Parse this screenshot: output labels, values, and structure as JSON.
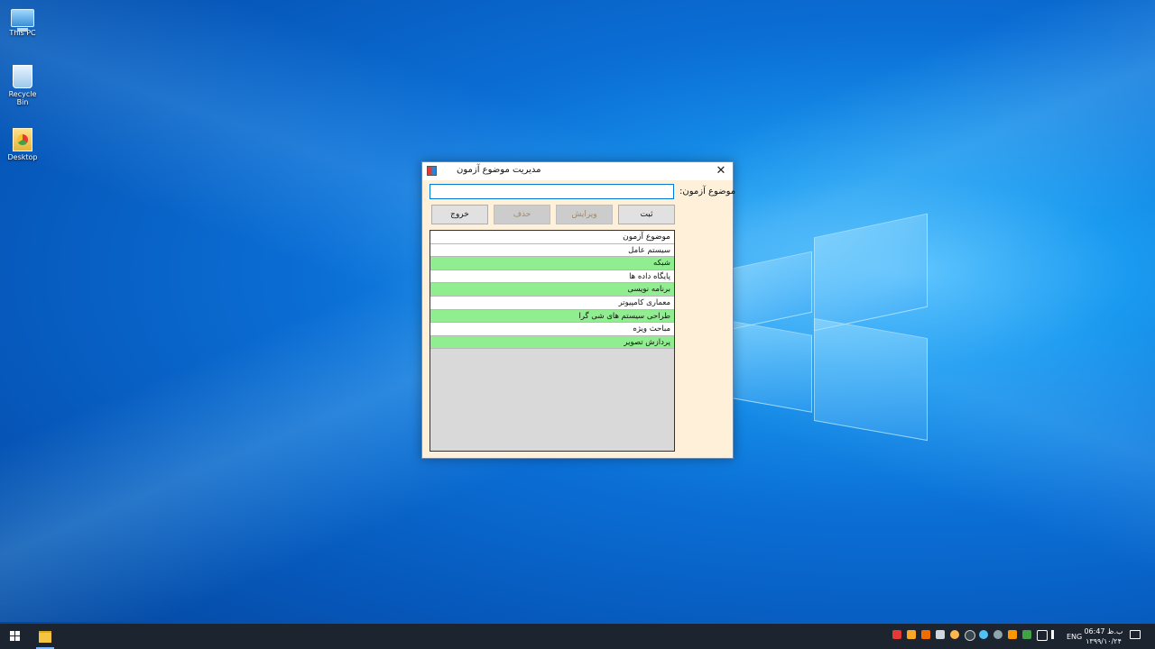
{
  "desktop": {
    "icons": [
      {
        "label": "This PC",
        "icon": "computer-icon"
      },
      {
        "label": "Recycle Bin",
        "icon": "recycle-bin-icon"
      },
      {
        "label": "Desktop",
        "icon": "shortcut-icon"
      }
    ]
  },
  "window": {
    "title": "مدیریت موضوع آزمون",
    "close_glyph": "✕",
    "form": {
      "subject_label": "موضوع آزمون:",
      "subject_value": "",
      "subject_placeholder": ""
    },
    "buttons": {
      "save": "ثبت",
      "edit": "ویرایش",
      "delete": "حذف",
      "exit": "خروج"
    },
    "list": {
      "header": "موضوع آزمون",
      "items": [
        {
          "text": "سیستم عامل",
          "highlight": false
        },
        {
          "text": "شبکه",
          "highlight": true
        },
        {
          "text": "پایگاه داده ها",
          "highlight": false
        },
        {
          "text": "برنامه نویسی",
          "highlight": true
        },
        {
          "text": "معماری کامپیوتر",
          "highlight": false
        },
        {
          "text": "طراحی سیستم های شی گرا",
          "highlight": true
        },
        {
          "text": "مباحث ویژه",
          "highlight": false
        },
        {
          "text": "پردازش تصویر",
          "highlight": true
        }
      ]
    }
  },
  "taskbar": {
    "language": "ENG",
    "clock_time": "ب.ظ 06:47",
    "clock_date": "۱۳۹۹/۱۰/۲۴"
  },
  "colors": {
    "highlight_row": "#90ee90",
    "client_bg": "#fff1d9",
    "input_border": "#0078d7"
  }
}
